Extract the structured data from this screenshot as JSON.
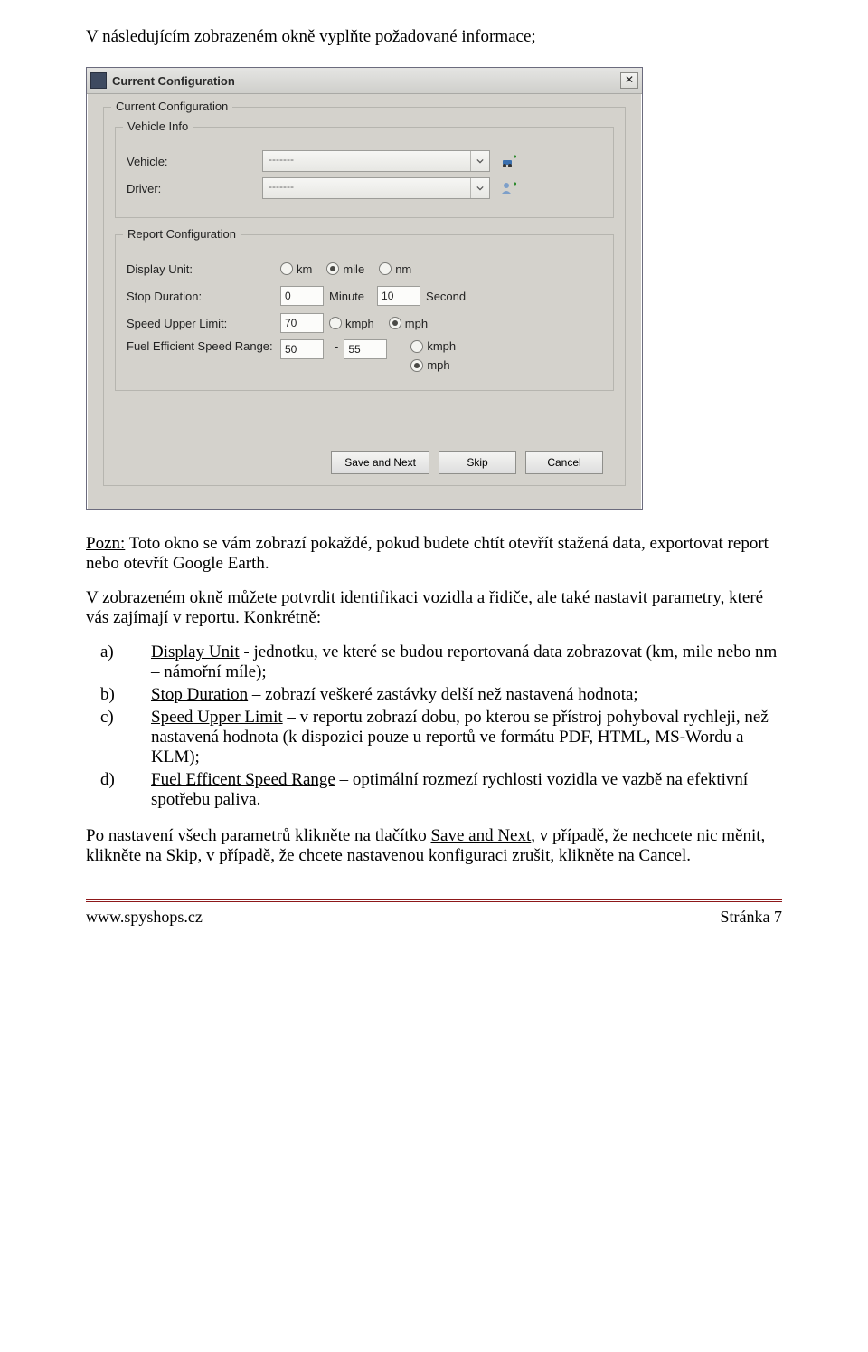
{
  "intro": "V následujícím zobrazeném okně vyplňte požadované informace;",
  "dialog": {
    "title": "Current Configuration",
    "outer_group": "Current Configuration",
    "vehicle_group": "Vehicle Info",
    "vehicle_label": "Vehicle:",
    "vehicle_value": "-------",
    "driver_label": "Driver:",
    "driver_value": "-------",
    "report_group": "Report Configuration",
    "display_unit_label": "Display Unit:",
    "unit_km": "km",
    "unit_mile": "mile",
    "unit_nm": "nm",
    "stop_duration_label": "Stop Duration:",
    "stop_min": "0",
    "stop_min_unit": "Minute",
    "stop_sec": "10",
    "stop_sec_unit": "Second",
    "speed_limit_label": "Speed Upper Limit:",
    "speed_limit_val": "70",
    "kmph": "kmph",
    "mph": "mph",
    "fuel_label": "Fuel Efficient Speed Range:",
    "fuel_lo": "50",
    "fuel_hi": "55",
    "dash": "-",
    "btn_save": "Save and Next",
    "btn_skip": "Skip",
    "btn_cancel": "Cancel"
  },
  "note": {
    "prefix": "Pozn:",
    "text": " Toto okno se vám zobrazí pokaždé, pokud budete chtít otevřít stažená data, exportovat report nebo otevřít Google Earth."
  },
  "para2": "V zobrazeném okně můžete potvrdit identifikaci vozidla a řidiče, ale také nastavit parametry, které vás zajímají v reportu. Konkrétně:",
  "list": {
    "a_m": "a)",
    "a_u": "Display Unit",
    "a_t": " - jednotku, ve které se budou reportovaná data zobrazovat (km, mile nebo nm – námořní míle);",
    "b_m": "b)",
    "b_u": "Stop Duration",
    "b_t": " – zobrazí veškeré zastávky delší než nastavená hodnota;",
    "c_m": "c)",
    "c_u": "Speed Upper Limit",
    "c_t": " – v reportu zobrazí dobu, po kterou se přístroj pohyboval rychleji, než nastavená hodnota (k dispozici pouze u reportů ve formátu PDF, HTML, MS-Wordu a KLM);",
    "d_m": "d)",
    "d_u": "Fuel Efficent Speed Range",
    "d_t": " – optimální rozmezí rychlosti vozidla ve vazbě na efektivní spotřebu paliva."
  },
  "para3": {
    "t1": "Po nastavení všech parametrů klikněte na tlačítko ",
    "u1": "Save and Next",
    "t2": ", v případě, že nechcete nic měnit, klikněte na ",
    "u2": "Skip",
    "t3": ", v případě, že chcete nastavenou konfiguraci zrušit, klikněte na ",
    "u3": "Cancel",
    "t4": "."
  },
  "footer": {
    "left": "www.spyshops.cz",
    "right": "Stránka 7"
  }
}
